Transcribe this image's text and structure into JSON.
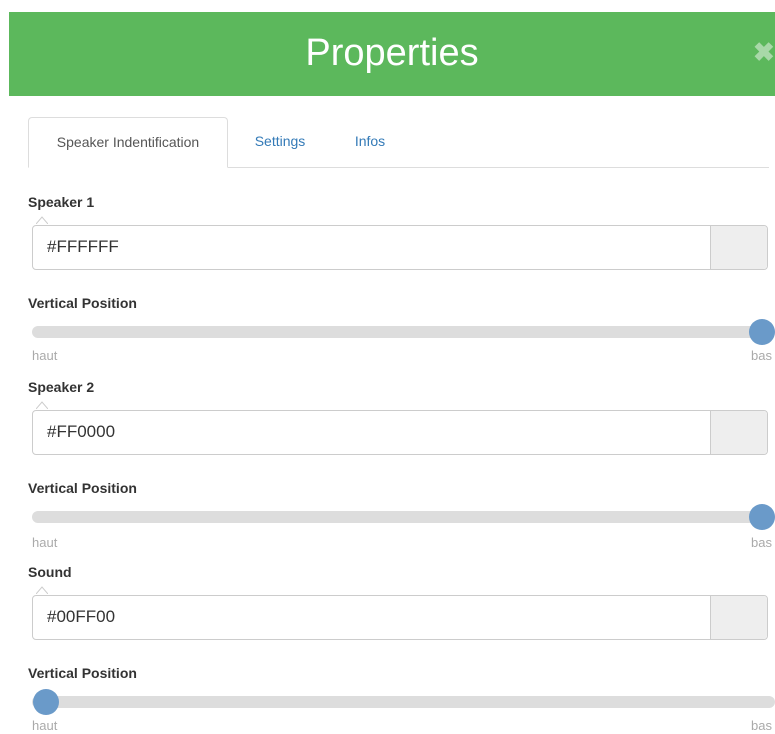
{
  "dialog": {
    "title": "Properties",
    "close_glyph": "✖"
  },
  "tabs": [
    {
      "label": "Speaker Indentification",
      "active": true
    },
    {
      "label": "Settings",
      "active": false
    },
    {
      "label": "Infos",
      "active": false
    }
  ],
  "sections": [
    {
      "label": "Speaker 1",
      "color_value": "#FFFFFF",
      "slider_label": "Vertical Position",
      "slider_value": 1.0,
      "min_label": "haut",
      "max_label": "bas"
    },
    {
      "label": "Speaker 2",
      "color_value": "#FF0000",
      "slider_label": "Vertical Position",
      "slider_value": 1.0,
      "min_label": "haut",
      "max_label": "bas"
    },
    {
      "label": "Sound",
      "color_value": "#00FF00",
      "slider_label": "Vertical Position",
      "slider_value": 0.0,
      "min_label": "haut",
      "max_label": "bas"
    }
  ],
  "theme": {
    "header_color": "#5cb85c",
    "slider_handle_color": "#6a9ac9",
    "link_color": "#337ab7"
  }
}
